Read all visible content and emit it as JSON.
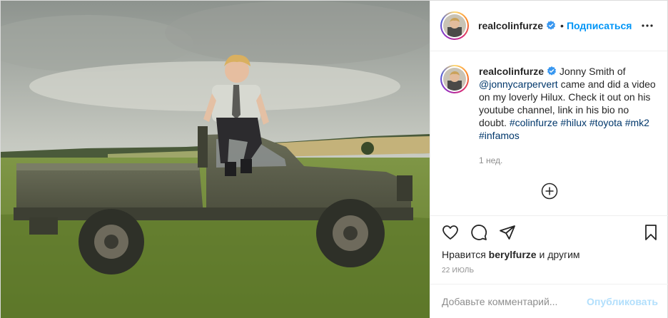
{
  "post": {
    "photo": {
      "alt": ""
    },
    "header": {
      "username": "realcolinfurze",
      "dot": "•",
      "follow_label": "Подписаться",
      "more_icon": "more-horizontal-icon",
      "verified_icon": "verified-badge-icon"
    },
    "caption": {
      "username": "realcolinfurze",
      "text_1": "Jonny Smith of ",
      "mention": "@jonnycarpervert",
      "text_2": " came and did a video on my loverly Hilux. Check it out on his youtube channel, link in his bio no doubt. ",
      "hashtags": "#colinfurze #hilux #toyota #mk2 #infamos",
      "time": "1 нед."
    },
    "actions": {
      "like_icon": "heart-icon",
      "comment_icon": "comment-icon",
      "share_icon": "share-icon",
      "save_icon": "bookmark-icon",
      "add_icon": "plus-circle-icon",
      "likes_prefix": "Нравится ",
      "likes_user": "berylfurze",
      "likes_suffix": " и другим",
      "date": "22 ИЮЛЬ"
    },
    "comment": {
      "placeholder": "Добавьте комментарий...",
      "publish_label": "Опубликовать"
    }
  },
  "colors": {
    "accent": "#0095f6",
    "publish_disabled": "#b2dffc",
    "muted": "#8e8e8e",
    "text": "#262626"
  }
}
